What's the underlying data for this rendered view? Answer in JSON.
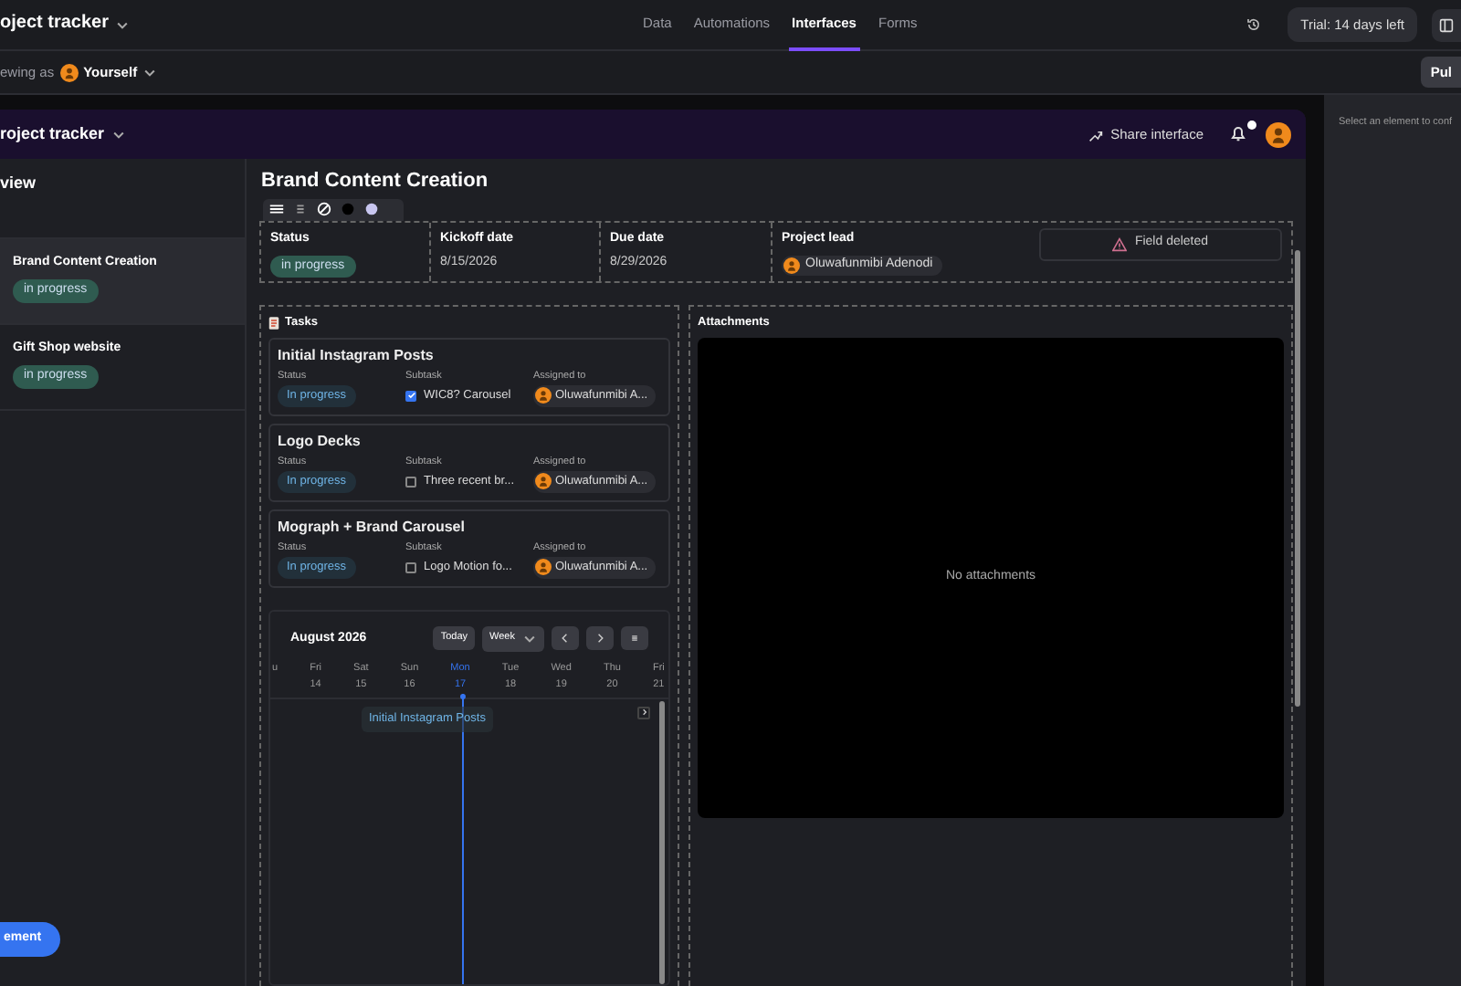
{
  "app_bar": {
    "title": "oject tracker",
    "nav": [
      {
        "label": "Data",
        "selected": false
      },
      {
        "label": "Automations",
        "selected": false
      },
      {
        "label": "Interfaces",
        "selected": true
      },
      {
        "label": "Forms",
        "selected": false
      }
    ],
    "trial": "Trial: 14 days left"
  },
  "sub_bar": {
    "viewing_label": "ewing as",
    "viewer": "Yourself",
    "publish": "Pul"
  },
  "interface": {
    "title": "roject tracker",
    "share": "Share interface",
    "notification_dot": true
  },
  "sidebar": {
    "heading": "view",
    "items": [
      {
        "title": "Brand Content Creation",
        "status": "in progress",
        "selected": true
      },
      {
        "title": "Gift Shop website",
        "status": "in progress",
        "selected": false
      }
    ],
    "button": "ement"
  },
  "record": {
    "title": "Brand Content Creation",
    "fields": [
      {
        "kind": "badge",
        "label": "Status",
        "value": "in progress"
      },
      {
        "kind": "text",
        "label": "Kickoff date",
        "value": "8/15/2026"
      },
      {
        "kind": "text",
        "label": "Due date",
        "value": "8/29/2026"
      },
      {
        "kind": "person",
        "label": "Project lead",
        "value": "Oluwafunmibi Adenodi"
      },
      {
        "kind": "deleted",
        "value": "Field deleted"
      }
    ]
  },
  "tasks": {
    "heading": "Tasks",
    "items": [
      {
        "title": "Initial Instagram Posts",
        "status_label": "Status",
        "status": "In progress",
        "subtask_label": "Subtask",
        "subtask": "WIC8? Carousel",
        "checked": true,
        "assigned_label": "Assigned to",
        "assignee": "Oluwafunmibi A..."
      },
      {
        "title": "Logo Decks",
        "status_label": "Status",
        "status": "In progress",
        "subtask_label": "Subtask",
        "subtask": "Three recent br...",
        "checked": false,
        "assigned_label": "Assigned to",
        "assignee": "Oluwafunmibi A..."
      },
      {
        "title": "Mograph + Brand Carousel",
        "status_label": "Status",
        "status": "In progress",
        "subtask_label": "Subtask",
        "subtask": "Logo Motion fo...",
        "checked": false,
        "assigned_label": "Assigned to",
        "assignee": "Oluwafunmibi A..."
      }
    ]
  },
  "calendar": {
    "month": "August 2026",
    "today": "Today",
    "view": "Week",
    "days": [
      {
        "weekday": "u",
        "selected": false
      },
      {
        "weekday": "Fri",
        "date": "14",
        "selected": false
      },
      {
        "weekday": "Sat",
        "date": "15",
        "selected": false
      },
      {
        "weekday": "Sun",
        "date": "16",
        "selected": false
      },
      {
        "weekday": "Mon",
        "date": "17",
        "selected": true
      },
      {
        "weekday": "Tue",
        "date": "18",
        "selected": false
      },
      {
        "weekday": "Wed",
        "date": "19",
        "selected": false
      },
      {
        "weekday": "Thu",
        "date": "20",
        "selected": false
      },
      {
        "weekday": "Fri",
        "date": "21",
        "selected": false
      }
    ],
    "event": "Initial Instagram Posts"
  },
  "attachments": {
    "heading": "Attachments",
    "empty": "No attachments"
  },
  "inspector": {
    "hint": "Select an element to conf"
  }
}
